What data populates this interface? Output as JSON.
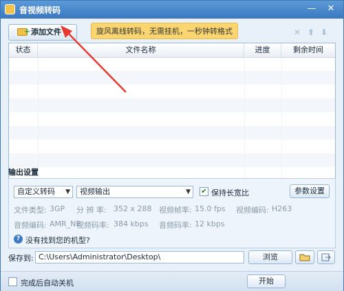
{
  "window": {
    "title": "音视频转码",
    "minimize": "—",
    "close": "✕"
  },
  "toolbar": {
    "add_file_label": "添加文件",
    "banner_text": "旋风离线转码，无需挂机，一秒钟转格式",
    "delete_icon": "✕",
    "move_up_icon": "⬆",
    "move_down_icon": "⬇"
  },
  "file_list": {
    "columns": [
      "状态",
      "文件名称",
      "进度",
      "剩余时间"
    ],
    "rows": []
  },
  "output_settings": {
    "section_title": "输出设置",
    "preset_select": "自定义转码",
    "format_select": "视频输出",
    "keep_ratio_label": "保持长宽比",
    "keep_ratio_checked": true,
    "params_button": "参数设置",
    "fields": [
      {
        "label": "文件类型:",
        "value": "3GP"
      },
      {
        "label": "分 辨 率:",
        "value": "352 x 288"
      },
      {
        "label": "视频帧率:",
        "value": "15.0 fps"
      },
      {
        "label": "视频编码:",
        "value": "H263"
      },
      {
        "label": "音频编码:",
        "value": "AMR_NB"
      },
      {
        "label": "视频码率:",
        "value": "384 kbps"
      },
      {
        "label": "音频码率:",
        "value": "12 kbps"
      }
    ],
    "help_link": "没有找到您的机型?"
  },
  "save": {
    "label": "保存到:",
    "path": "C:\\Users\\Administrator\\Desktop\\",
    "browse_button": "浏览"
  },
  "footer": {
    "auto_shutdown_label": "完成后自动关机",
    "auto_shutdown_checked": false,
    "start_button": "开始"
  },
  "colors": {
    "accent": "#3a78c0",
    "annotation_arrow": "#e53a33",
    "banner": "#fbd570"
  }
}
